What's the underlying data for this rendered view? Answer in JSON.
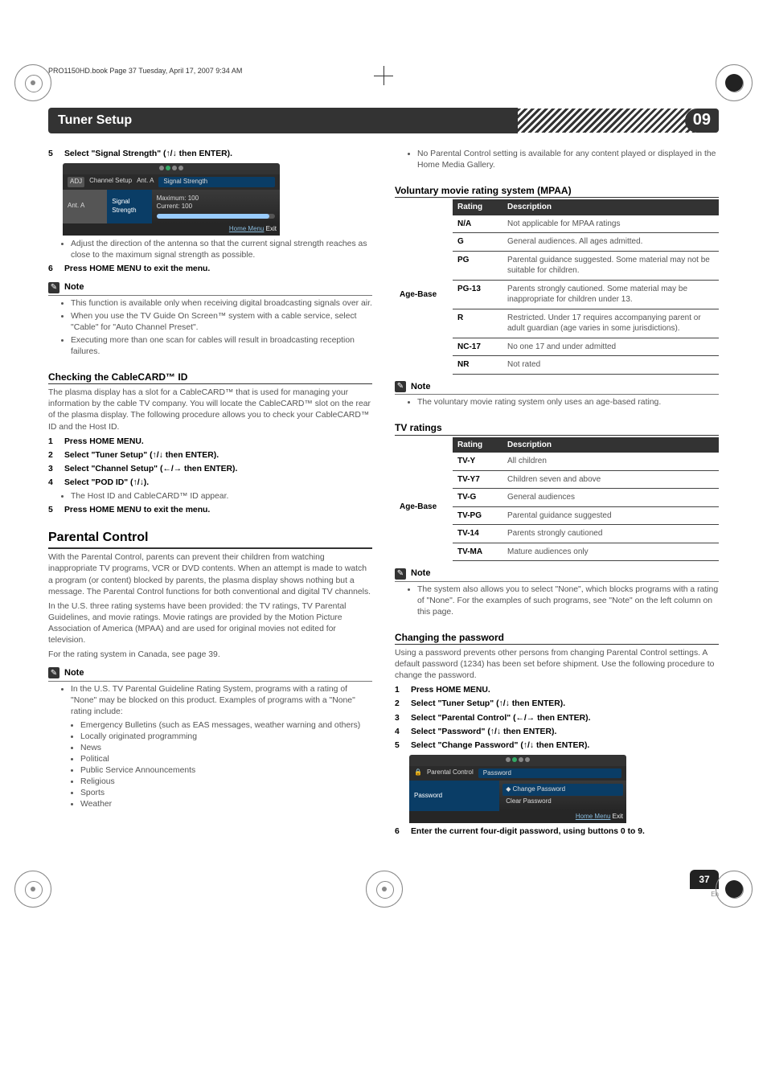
{
  "print_meta": "PRO1150HD.book  Page 37  Tuesday, April 17, 2007  9:34 AM",
  "chapter": {
    "title": "Tuner Setup",
    "num": "09"
  },
  "left": {
    "step5": {
      "n": "5",
      "text": "Select \"Signal Strength\" (↑/↓ then ENTER)."
    },
    "osd1": {
      "crumb_icon": "ADJ",
      "crumb1": "Channel Setup",
      "crumb2": "Ant. A",
      "crumb3": "Signal Strength",
      "l1": "Ant. A",
      "l2": "Signal Strength",
      "max_lbl": "Maximum:",
      "max_val": "100",
      "cur_lbl": "Current:",
      "cur_val": "100",
      "foot1": "Home Menu",
      "foot2": "Exit"
    },
    "bullet_adjust": "Adjust the direction of the antenna so that the current signal strength reaches as close to the maximum signal strength as possible.",
    "step6": {
      "n": "6",
      "text": "Press HOME MENU to exit the menu."
    },
    "note1_label": "Note",
    "note1_items": [
      "This function is available only when receiving digital broadcasting signals over air.",
      "When you use the TV Guide On Screen™ system with a cable service, select \"Cable\" for \"Auto Channel Preset\".",
      "Executing more than one scan for cables will result in broadcasting reception failures."
    ],
    "sec_cable": "Checking the CableCARD™ ID",
    "cable_para": "The plasma display has a slot for a CableCARD™ that is used for managing your information by the cable TV company. You will locate the CableCARD™ slot on the rear of the plasma display. The following procedure allows you to check your CableCARD™ ID and the Host ID.",
    "cc_steps": [
      {
        "n": "1",
        "t": "Press HOME MENU."
      },
      {
        "n": "2",
        "t": "Select \"Tuner Setup\" (↑/↓ then ENTER)."
      },
      {
        "n": "3",
        "t": "Select \"Channel Setup\" (←/→ then ENTER)."
      },
      {
        "n": "4",
        "t": "Select \"POD ID\" (↑/↓)."
      }
    ],
    "cc_sub": "The Host ID and CableCARD™ ID appear.",
    "cc_step5": {
      "n": "5",
      "t": "Press HOME MENU to exit the menu."
    },
    "sec_parental": "Parental Control",
    "pc_para1": "With the Parental Control, parents can prevent their children from watching inappropriate TV programs, VCR or DVD contents. When an attempt is made to watch a program (or content) blocked by parents, the plasma display shows nothing but a message. The Parental Control functions for both conventional and digital TV channels.",
    "pc_para2": "In the U.S. three rating systems have been provided: the TV ratings, TV Parental Guidelines, and movie ratings. Movie ratings are provided by the Motion Picture Association of America (MPAA) and are used for original movies not edited for television.",
    "pc_para3": "For the rating system in Canada, see page 39.",
    "note2_label": "Note",
    "note2_lead": "In the U.S. TV Parental Guideline Rating System, programs with a rating of \"None\" may be blocked on this product. Examples of programs with a \"None\" rating include:",
    "note2_items": [
      "Emergency Bulletins (such as EAS messages, weather warning and others)",
      "Locally originated programming",
      "News",
      "Political",
      "Public Service Announcements",
      "Religious",
      "Sports",
      "Weather"
    ]
  },
  "right": {
    "top_bullet": "No Parental Control setting is available for any content played or displayed in the Home Media Gallery.",
    "sec_mpaa": "Voluntary movie rating system (MPAA)",
    "mpaa_th1": "Rating",
    "mpaa_th2": "Description",
    "mpaa_age": "Age-Base",
    "mpaa_rows": [
      {
        "r": "N/A",
        "d": "Not applicable for MPAA ratings"
      },
      {
        "r": "G",
        "d": "General audiences. All ages admitted."
      },
      {
        "r": "PG",
        "d": "Parental guidance suggested. Some material may not be suitable for children."
      },
      {
        "r": "PG-13",
        "d": "Parents strongly cautioned. Some material may be inappropriate for children under 13."
      },
      {
        "r": "R",
        "d": "Restricted. Under 17 requires accompanying parent or adult guardian (age varies in some jurisdictions)."
      },
      {
        "r": "NC-17",
        "d": "No one 17 and under admitted"
      },
      {
        "r": "NR",
        "d": "Not rated"
      }
    ],
    "note3_label": "Note",
    "note3_text": "The voluntary movie rating system only uses an age-based rating.",
    "sec_tv": "TV ratings",
    "tv_th1": "Rating",
    "tv_th2": "Description",
    "tv_age": "Age-Base",
    "tv_rows": [
      {
        "r": "TV-Y",
        "d": "All children"
      },
      {
        "r": "TV-Y7",
        "d": "Children seven and above"
      },
      {
        "r": "TV-G",
        "d": "General audiences"
      },
      {
        "r": "TV-PG",
        "d": "Parental guidance suggested"
      },
      {
        "r": "TV-14",
        "d": "Parents strongly cautioned"
      },
      {
        "r": "TV-MA",
        "d": "Mature audiences only"
      }
    ],
    "note4_label": "Note",
    "note4_text": "The system also allows you to select \"None\", which blocks programs with a rating of \"None\". For the examples of such programs, see \"Note\" on the left column on this page.",
    "sec_pw": "Changing the password",
    "pw_para": "Using a password prevents other persons from changing Parental Control settings. A default password (1234) has been set before shipment. Use the following procedure to change the password.",
    "pw_steps": [
      {
        "n": "1",
        "t": "Press HOME MENU."
      },
      {
        "n": "2",
        "t": "Select \"Tuner Setup\" (↑/↓ then ENTER)."
      },
      {
        "n": "3",
        "t": "Select \"Parental Control\" (←/→ then ENTER)."
      },
      {
        "n": "4",
        "t": "Select \"Password\" (↑/↓ then ENTER)."
      },
      {
        "n": "5",
        "t": "Select \"Change Password\" (↑/↓ then ENTER)."
      }
    ],
    "osd2": {
      "crumb_icon": "🔒",
      "crumb1": "Parental Control",
      "crumb2": "Password",
      "l1": "Password",
      "r1": "Change Password",
      "r2": "Clear Password",
      "foot1": "Home Menu",
      "foot2": "Exit"
    },
    "step6": {
      "n": "6",
      "t": "Enter the current four-digit password, using buttons 0 to 9."
    }
  },
  "page_num": "37",
  "lang": "En"
}
